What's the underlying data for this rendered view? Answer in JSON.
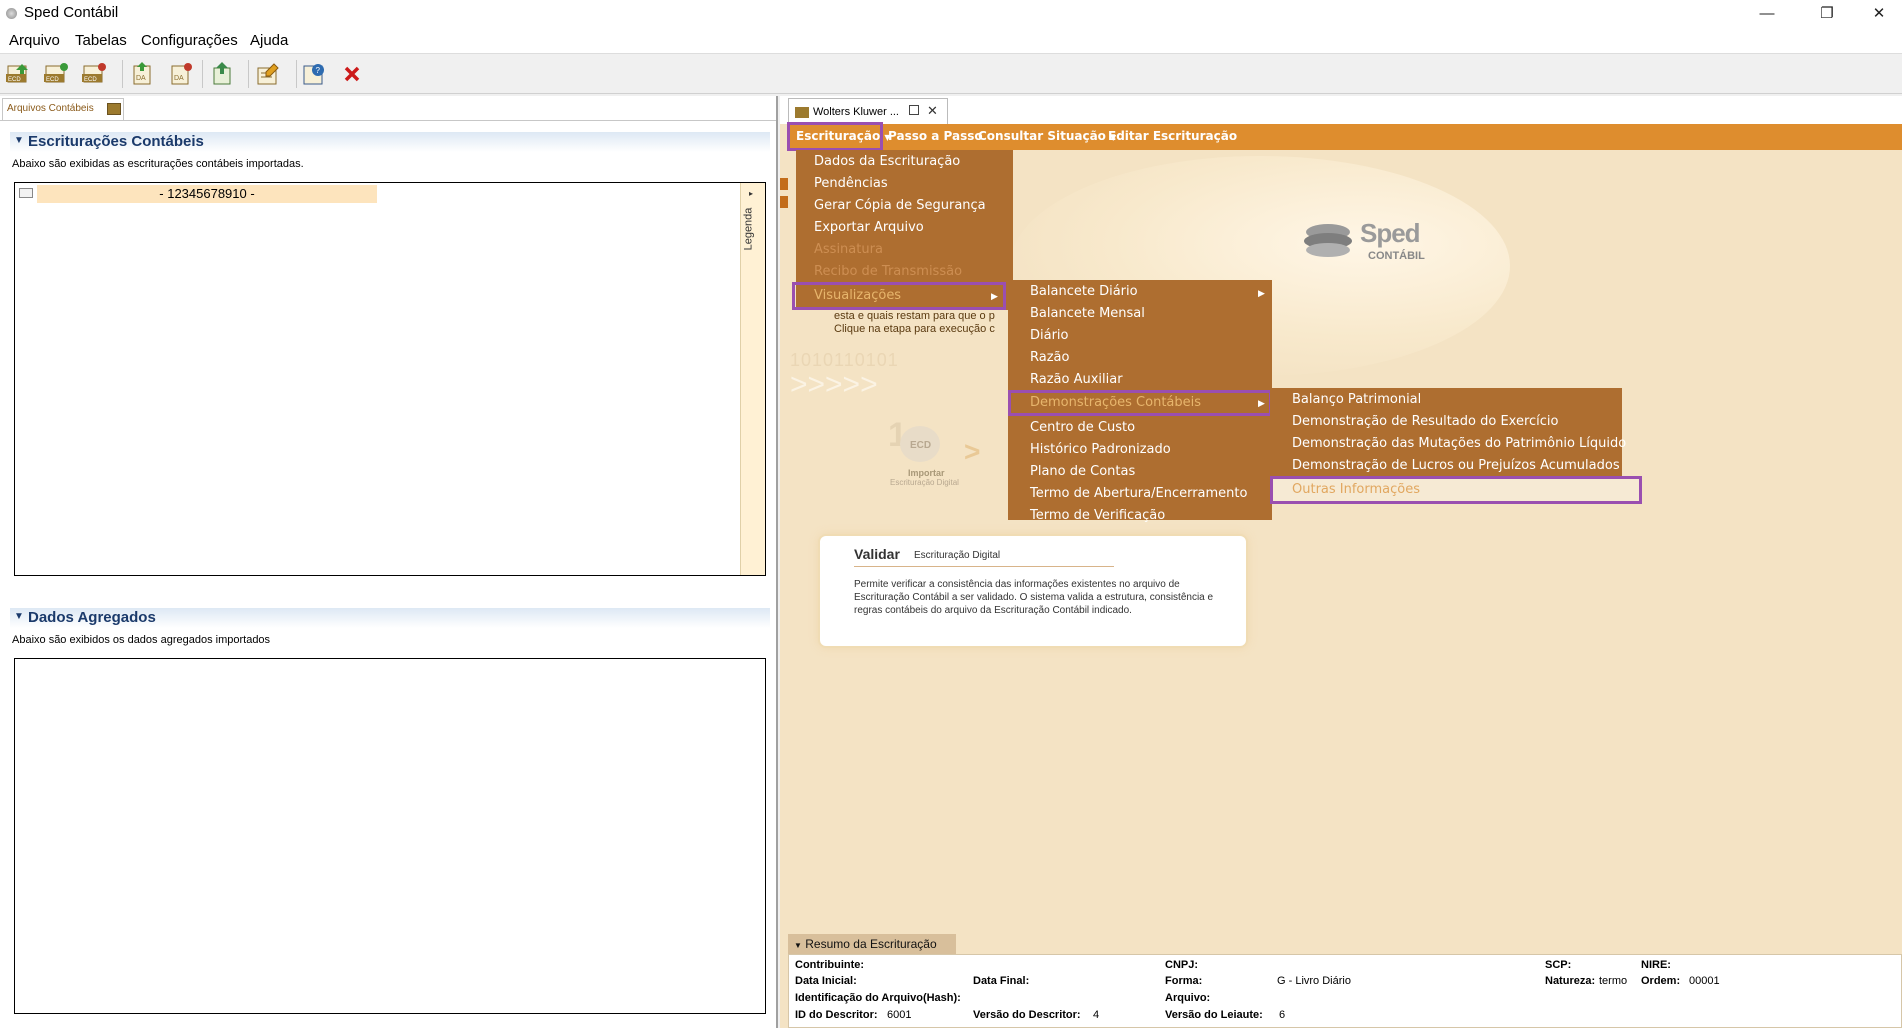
{
  "window": {
    "title": "Sped Contábil",
    "minimize": "—",
    "maximize": "❐",
    "close": "✕"
  },
  "menubar": {
    "items": [
      "Arquivo",
      "Tabelas",
      "Configurações",
      "Ajuda"
    ]
  },
  "toolbar": {
    "icons": [
      "import-ecd-icon",
      "import-ecd2-icon",
      "import-ecd3-icon",
      "import-dados-agregados-icon",
      "import-dados-agregados2-icon",
      "export-icon",
      "edit-icon",
      "help-icon",
      "close-red-icon"
    ]
  },
  "left": {
    "tab_label": "Arquivos Contábeis",
    "escrituracoes": {
      "title": "Escriturações Contábeis",
      "subtitle": "Abaixo são exibidas as escriturações contábeis importadas.",
      "tree_item": "- 12345678910 -",
      "legenda": "Legenda"
    },
    "agregados": {
      "title": "Dados Agregados",
      "subtitle": "Abaixo são exibidos os dados agregados importados"
    }
  },
  "right": {
    "tab_label": "Wolters Kluwer ...",
    "menu_bar": {
      "escrituracao": "Escrituração",
      "passo": "Passo a Passo",
      "consultar": "Consultar Situação",
      "editar": "Editar Escrituração"
    },
    "escrituracao_menu": [
      {
        "label": "Dados da Escrituração",
        "state": "normal"
      },
      {
        "label": "Pendências",
        "state": "normal"
      },
      {
        "label": "Gerar Cópia de Segurança",
        "state": "normal"
      },
      {
        "label": "Exportar Arquivo",
        "state": "normal"
      },
      {
        "label": "Assinatura",
        "state": "disabled"
      },
      {
        "label": "Recibo de Transmissão",
        "state": "disabled"
      },
      {
        "label": "Visualizações",
        "state": "highlight"
      }
    ],
    "visualizacoes_menu": [
      "Balancete Diário",
      "Balancete Mensal",
      "Diário",
      "Razão",
      "Razão Auxiliar",
      "Demonstrações Contábeis",
      "Centro de Custo",
      "Histórico Padronizado",
      "Plano de Contas",
      "Termo de Abertura/Encerramento",
      "Termo de Verificação"
    ],
    "demonstracoes_menu": [
      "Balanço Patrimonial",
      "Demonstração de Resultado do Exercício",
      "Demonstração das Mutações do Patrimônio Líquido",
      "Demonstração de Lucros ou Prejuízos Acumulados",
      "Outras Informações"
    ],
    "bg_text": {
      "line1": "esta e quais restam para que o p",
      "line2": "Clique na etapa para execução c",
      "digits": "1010110101",
      "importar": "Importar",
      "importar_sub": "Escrituração Digital",
      "ecd": "ECD"
    },
    "logo": {
      "sped": "Sped",
      "contabil": "CONTÁBIL"
    },
    "validar": {
      "title": "Validar",
      "subtitle": "Escrituração Digital",
      "text": "Permite verificar a consistência das informações existentes no arquivo de Escrituração Contábil a ser validado. O sistema valida a estrutura, consistência e regras contábeis do arquivo da Escrituração Contábil indicado."
    },
    "resumo": {
      "tab": "Resumo da Escrituração",
      "contribuinte": "Contribuinte:",
      "cnpj": "CNPJ:",
      "scp": "SCP:",
      "nire": "NIRE:",
      "data_inicial": "Data Inicial:",
      "data_final": "Data Final:",
      "forma": "Forma:",
      "forma_val": "G - Livro Diário",
      "natureza": "Natureza:",
      "natureza_val": "termo",
      "ordem": "Ordem:",
      "ordem_val": "00001",
      "hash": "Identificação do Arquivo(Hash):",
      "arquivo": "Arquivo:",
      "id_desc": "ID do Descritor:",
      "id_desc_val": "6001",
      "versao_desc": "Versão do Descritor:",
      "versao_desc_val": "4",
      "versao_leiaute": "Versão do Leiaute:",
      "versao_leiaute_val": "6"
    }
  }
}
